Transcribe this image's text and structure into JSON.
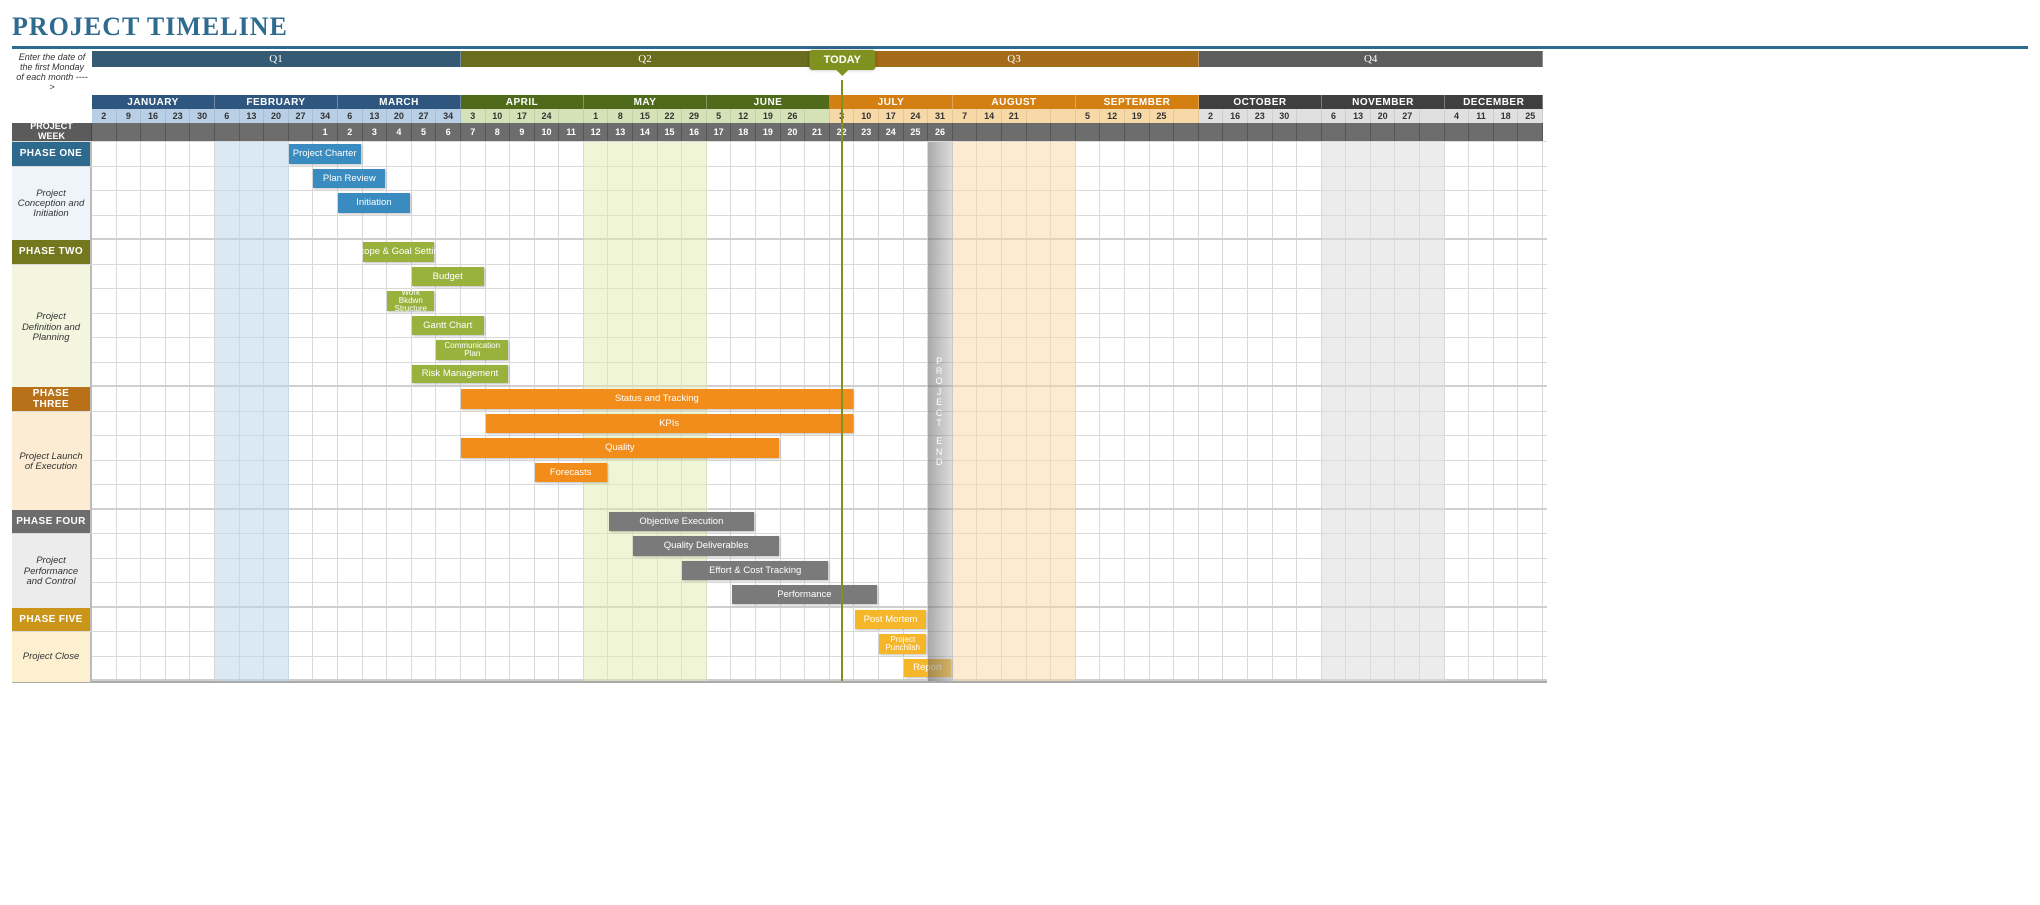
{
  "title": "PROJECT TIMELINE",
  "instruction": "Enter the date of the first Monday of each month ---->",
  "project_week_label": "PROJECT WEEK",
  "today_label": "TODAY",
  "project_end_label": "PROJECT END",
  "today_col": 30,
  "project_end_col": 34,
  "quarters": [
    {
      "label": "Q1",
      "span": 15,
      "color": "var(--q1)"
    },
    {
      "label": "Q2",
      "span": 15,
      "color": "var(--q2)"
    },
    {
      "label": "Q3",
      "span": 15,
      "color": "var(--q3)"
    },
    {
      "label": "Q4",
      "span": 14,
      "color": "var(--q4)"
    }
  ],
  "months": [
    {
      "label": "JANUARY",
      "span": 5,
      "color": "var(--month1)",
      "wk": "var(--week1)"
    },
    {
      "label": "FEBRUARY",
      "span": 5,
      "color": "var(--month1)",
      "wk": "var(--week1)"
    },
    {
      "label": "MARCH",
      "span": 5,
      "color": "var(--month1)",
      "wk": "var(--week1)"
    },
    {
      "label": "APRIL",
      "span": 5,
      "color": "var(--month2)",
      "wk": "var(--week2)"
    },
    {
      "label": "MAY",
      "span": 5,
      "color": "var(--month2)",
      "wk": "var(--week2)"
    },
    {
      "label": "JUNE",
      "span": 5,
      "color": "var(--month2)",
      "wk": "var(--week2)"
    },
    {
      "label": "JULY",
      "span": 5,
      "color": "var(--month3)",
      "wk": "var(--week3)"
    },
    {
      "label": "AUGUST",
      "span": 5,
      "color": "var(--month3)",
      "wk": "var(--week3)"
    },
    {
      "label": "SEPTEMBER",
      "span": 5,
      "color": "var(--month3)",
      "wk": "var(--week3)"
    },
    {
      "label": "OCTOBER",
      "span": 5,
      "color": "var(--month4)",
      "wk": "var(--week4)"
    },
    {
      "label": "NOVEMBER",
      "span": 5,
      "color": "var(--month4)",
      "wk": "var(--week4)"
    },
    {
      "label": "DECEMBER",
      "span": 4,
      "color": "var(--month4)",
      "wk": "var(--week4)"
    }
  ],
  "week_days": [
    "2",
    "9",
    "16",
    "23",
    "30",
    "6",
    "13",
    "20",
    "27",
    "34",
    "6",
    "13",
    "20",
    "27",
    "34",
    "3",
    "10",
    "17",
    "24",
    "",
    "1",
    "8",
    "15",
    "22",
    "29",
    "5",
    "12",
    "19",
    "26",
    "",
    "3",
    "10",
    "17",
    "24",
    "31",
    "7",
    "14",
    "21",
    "",
    "",
    "5",
    "12",
    "19",
    "25",
    "",
    "2",
    "16",
    "23",
    "30",
    "",
    "6",
    "13",
    "20",
    "27",
    "",
    "4",
    "11",
    "18",
    "25"
  ],
  "project_weeks": [
    "",
    "",
    "",
    "",
    "",
    "",
    "",
    "",
    "",
    "1",
    "2",
    "3",
    "4",
    "5",
    "6",
    "7",
    "8",
    "9",
    "10",
    "11",
    "12",
    "13",
    "14",
    "15",
    "16",
    "17",
    "18",
    "19",
    "20",
    "21",
    "22",
    "23",
    "24",
    "25",
    "26",
    "",
    "",
    "",
    "",
    "",
    "",
    "",
    "",
    "",
    "",
    "",
    "",
    "",
    "",
    "",
    "",
    "",
    "",
    "",
    "",
    "",
    "",
    "",
    ""
  ],
  "col_tints": [
    {
      "start": 5,
      "span": 3,
      "color": "rgba(190,215,235,.55)"
    },
    {
      "start": 20,
      "span": 5,
      "color": "rgba(225,235,175,.5)"
    },
    {
      "start": 35,
      "span": 5,
      "color": "rgba(250,215,160,.5)"
    },
    {
      "start": 50,
      "span": 5,
      "color": "rgba(220,220,220,.55)"
    }
  ],
  "phases": [
    {
      "id": "phase1",
      "name": "PHASE ONE",
      "sub": "Project Conception and Initiation",
      "head_color": "var(--phase1)",
      "side_bg": "#eef4fa",
      "bar_color": "var(--phase1-bar)",
      "rows": 3,
      "bars": [
        {
          "row": 0,
          "start": 8,
          "span": 3,
          "label": "Project Charter",
          "in_head": true
        },
        {
          "row": 1,
          "start": 9,
          "span": 3,
          "label": "Plan Review"
        },
        {
          "row": 2,
          "start": 10,
          "span": 3,
          "label": "Initiation"
        }
      ]
    },
    {
      "id": "phase2",
      "name": "PHASE TWO",
      "sub": "Project Definition and Planning",
      "head_color": "var(--phase2)",
      "side_bg": "#f3f5df",
      "bar_color": "var(--phase2-bar)",
      "rows": 5,
      "bars": [
        {
          "row": 0,
          "start": 11,
          "span": 3,
          "label": "Scope & Goal Setting",
          "in_head": true
        },
        {
          "row": 1,
          "start": 13,
          "span": 3,
          "label": "Budget"
        },
        {
          "row": 2,
          "start": 12,
          "span": 2,
          "label": "Work Bkdwn Structure",
          "small": true
        },
        {
          "row": 3,
          "start": 13,
          "span": 3,
          "label": "Gantt Chart"
        },
        {
          "row": 4,
          "start": 14,
          "span": 3,
          "label": "Communication Plan",
          "small": true
        },
        {
          "row": 5,
          "start": 13,
          "span": 4,
          "label": "Risk Management"
        }
      ]
    },
    {
      "id": "phase3",
      "name": "PHASE THREE",
      "sub": "Project Launch of Execution",
      "head_color": "var(--phase3)",
      "side_bg": "#fcecd3",
      "bar_color": "var(--phase3-bar)",
      "rows": 4,
      "bars": [
        {
          "row": 0,
          "start": 15,
          "span": 16,
          "label": "Status  and Tracking",
          "in_head": true
        },
        {
          "row": 1,
          "start": 16,
          "span": 15,
          "label": "KPIs"
        },
        {
          "row": 2,
          "start": 15,
          "span": 13,
          "label": "Quality"
        },
        {
          "row": 3,
          "start": 18,
          "span": 3,
          "label": "Forecasts"
        }
      ]
    },
    {
      "id": "phase4",
      "name": "PHASE FOUR",
      "sub": "Project Performance and Control",
      "head_color": "var(--phase4)",
      "side_bg": "#ececec",
      "bar_color": "var(--phase4-bar)",
      "rows": 3,
      "bars": [
        {
          "row": 0,
          "start": 21,
          "span": 6,
          "label": "Objective Execution",
          "in_head": true
        },
        {
          "row": 1,
          "start": 22,
          "span": 6,
          "label": "Quality Deliverables"
        },
        {
          "row": 2,
          "start": 24,
          "span": 6,
          "label": "Effort & Cost Tracking"
        },
        {
          "row": 3,
          "start": 26,
          "span": 6,
          "label": "Performance"
        }
      ]
    },
    {
      "id": "phase5",
      "name": "PHASE FIVE",
      "sub": "Project Close",
      "head_color": "var(--phase5)",
      "side_bg": "#fdf0d0",
      "bar_color": "var(--phase5-bar)",
      "rows": 2,
      "bars": [
        {
          "row": 0,
          "start": 31,
          "span": 3,
          "label": "Post Mortem",
          "in_head": true
        },
        {
          "row": 1,
          "start": 32,
          "span": 2,
          "label": "Project Punchlish",
          "small": true
        },
        {
          "row": 2,
          "start": 33,
          "span": 2,
          "label": "Report"
        }
      ]
    }
  ],
  "chart_data": {
    "type": "bar",
    "title": "PROJECT TIMELINE",
    "xlabel": "Project Week",
    "x_units": "weeks",
    "x_range": [
      0,
      59
    ],
    "annotations": {
      "today_col": 30,
      "project_end_col": 34
    },
    "series": [
      {
        "group": "PHASE ONE",
        "name": "Project Charter",
        "start": 8,
        "duration": 3
      },
      {
        "group": "PHASE ONE",
        "name": "Plan Review",
        "start": 9,
        "duration": 3
      },
      {
        "group": "PHASE ONE",
        "name": "Initiation",
        "start": 10,
        "duration": 3
      },
      {
        "group": "PHASE TWO",
        "name": "Scope & Goal Setting",
        "start": 11,
        "duration": 3
      },
      {
        "group": "PHASE TWO",
        "name": "Budget",
        "start": 13,
        "duration": 3
      },
      {
        "group": "PHASE TWO",
        "name": "Work Bkdwn Structure",
        "start": 12,
        "duration": 2
      },
      {
        "group": "PHASE TWO",
        "name": "Gantt Chart",
        "start": 13,
        "duration": 3
      },
      {
        "group": "PHASE TWO",
        "name": "Communication Plan",
        "start": 14,
        "duration": 3
      },
      {
        "group": "PHASE TWO",
        "name": "Risk Management",
        "start": 13,
        "duration": 4
      },
      {
        "group": "PHASE THREE",
        "name": "Status and Tracking",
        "start": 15,
        "duration": 16
      },
      {
        "group": "PHASE THREE",
        "name": "KPIs",
        "start": 16,
        "duration": 15
      },
      {
        "group": "PHASE THREE",
        "name": "Quality",
        "start": 15,
        "duration": 13
      },
      {
        "group": "PHASE THREE",
        "name": "Forecasts",
        "start": 18,
        "duration": 3
      },
      {
        "group": "PHASE FOUR",
        "name": "Objective Execution",
        "start": 21,
        "duration": 6
      },
      {
        "group": "PHASE FOUR",
        "name": "Quality Deliverables",
        "start": 22,
        "duration": 6
      },
      {
        "group": "PHASE FOUR",
        "name": "Effort & Cost Tracking",
        "start": 24,
        "duration": 6
      },
      {
        "group": "PHASE FOUR",
        "name": "Performance",
        "start": 26,
        "duration": 6
      },
      {
        "group": "PHASE FIVE",
        "name": "Post Mortem",
        "start": 31,
        "duration": 3
      },
      {
        "group": "PHASE FIVE",
        "name": "Project Punchlish",
        "start": 32,
        "duration": 2
      },
      {
        "group": "PHASE FIVE",
        "name": "Report",
        "start": 33,
        "duration": 2
      }
    ]
  }
}
